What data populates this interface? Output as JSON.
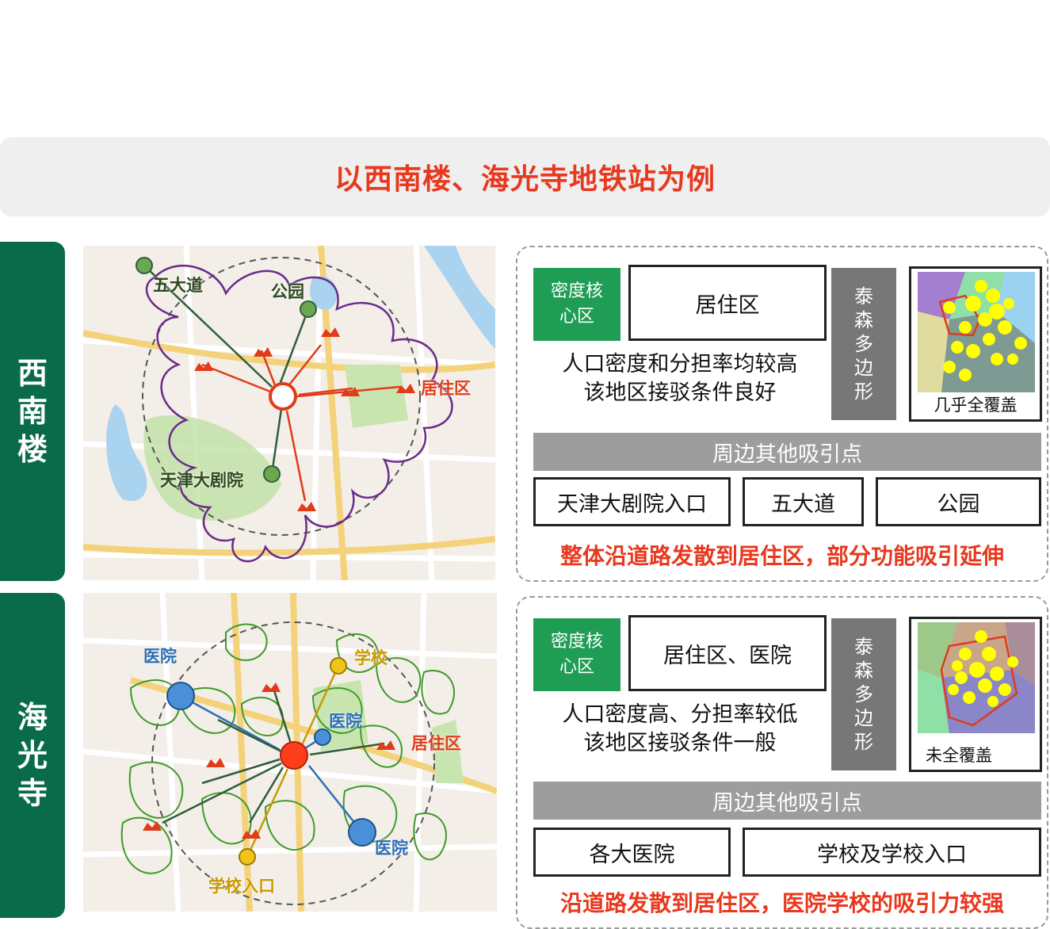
{
  "banner": {
    "title": "以西南楼、海光寺地铁站为例"
  },
  "sections": [
    {
      "name": "西南楼",
      "map_labels": [
        "五大道",
        "公园",
        "居住区",
        "天津大剧院"
      ],
      "density_tag": "密度核心区",
      "core_area": "居住区",
      "polygon_label": "泰森多边形",
      "thumb_caption": "几乎全覆盖",
      "desc_line1": "人口密度和分担率均较高",
      "desc_line2": "该地区接驳条件良好",
      "other_title": "周边其他吸引点",
      "attractions": [
        "天津大剧院入口",
        "五大道",
        "公园"
      ],
      "conclusion": "整体沿道路发散到居住区，部分功能吸引延伸"
    },
    {
      "name": "海光寺",
      "map_labels": [
        "医院",
        "学校",
        "医院",
        "居住区",
        "医院",
        "学校入口"
      ],
      "density_tag": "密度核心区",
      "core_area": "居住区、医院",
      "polygon_label": "泰森多边形",
      "thumb_caption": "未全覆盖",
      "desc_line1": "人口密度高、分担率较低",
      "desc_line2": "该地区接驳条件一般",
      "other_title": "周边其他吸引点",
      "attractions": [
        "各大医院",
        "学校及学校入口"
      ],
      "conclusion": "沿道路发散到居住区，医院学校的吸引力较强"
    }
  ],
  "colors": {
    "accent_red": "#e8381e",
    "brand_green": "#0a6b4a",
    "tag_green": "#1f9d55",
    "grey": "#777777",
    "label_green": "#3a7a2a",
    "label_blue": "#2e6fb5",
    "label_gold": "#c99a00"
  }
}
